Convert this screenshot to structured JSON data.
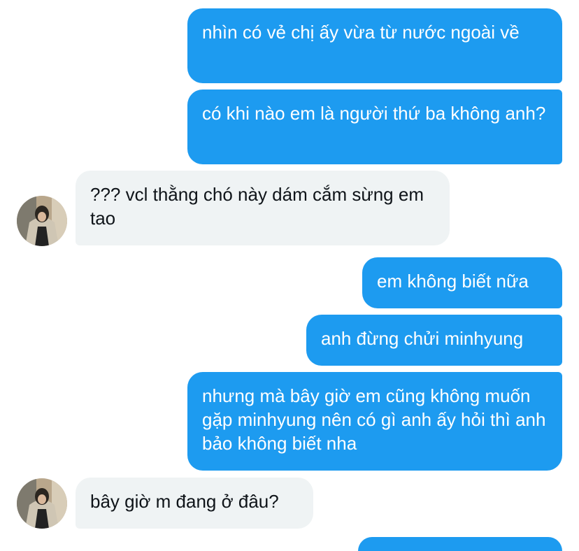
{
  "colors": {
    "outgoing_bubble": "#1d9bf0",
    "incoming_bubble": "#eff3f4",
    "outgoing_text": "#ffffff",
    "incoming_text": "#0f1419"
  },
  "messages": [
    {
      "direction": "outgoing",
      "text": "nhìn có vẻ chị ấy vừa từ nước ngoài về"
    },
    {
      "direction": "outgoing",
      "text": "có khi nào em là người thứ ba không anh?"
    },
    {
      "direction": "incoming",
      "text": "??? vcl thằng chó này dám cắm sừng em tao",
      "avatar": "user-avatar"
    },
    {
      "direction": "outgoing",
      "text": "em không biết nữa"
    },
    {
      "direction": "outgoing",
      "text": "anh đừng chửi minhyung"
    },
    {
      "direction": "outgoing",
      "text": "nhưng mà bây giờ em cũng không muốn gặp minhyung nên có gì anh ấy hỏi thì anh bảo không biết nha"
    },
    {
      "direction": "incoming",
      "text": "bây giờ m đang ở đâu?",
      "avatar": "user-avatar"
    }
  ]
}
